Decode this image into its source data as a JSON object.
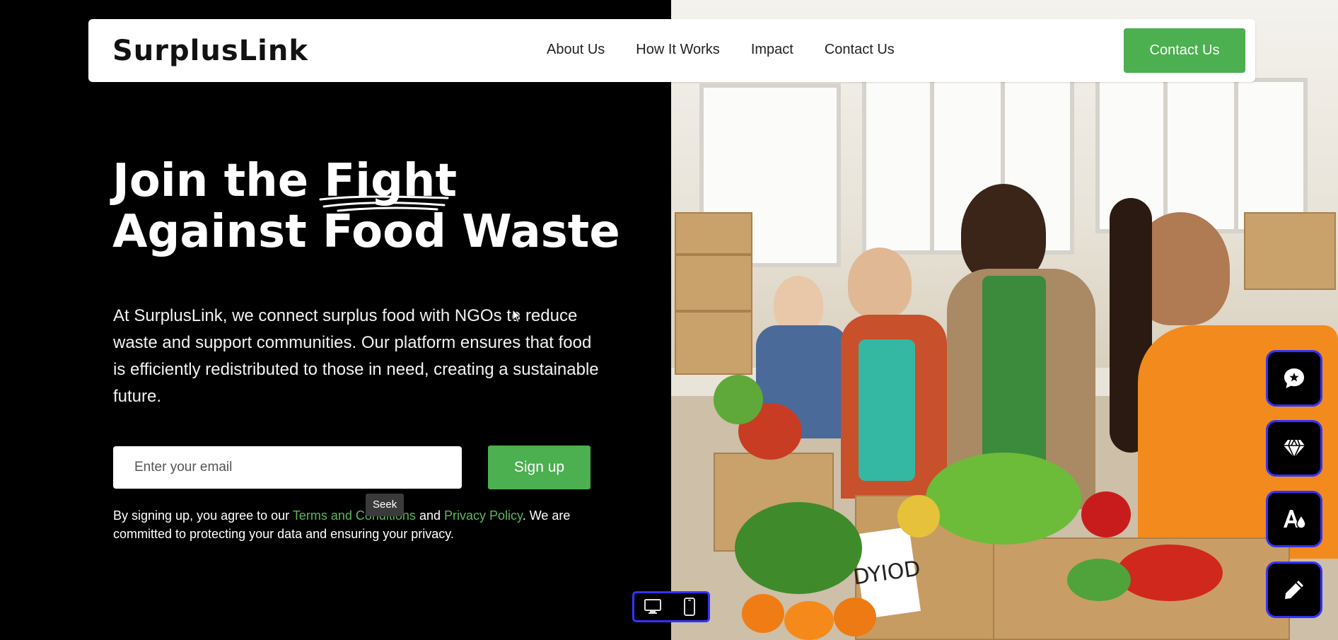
{
  "brand": {
    "logo": "SurplusLink",
    "accent_color": "#4caf50"
  },
  "nav": {
    "links": [
      "About Us",
      "How It Works",
      "Impact",
      "Contact Us"
    ],
    "cta_label": "Contact Us"
  },
  "hero": {
    "title_before": "Join the ",
    "title_highlight": "Fight",
    "title_after": " Against Food Waste",
    "description": "At SurplusLink, we connect surplus food with NGOs to reduce waste and support communities. Our platform ensures that food is efficiently redistributed to those in need, creating a sustainable future.",
    "email_placeholder": "Enter your email",
    "signup_label": "Sign up",
    "terms_before": "By signing up, you agree to our ",
    "terms_link": "Terms and Conditions",
    "terms_and": " and ",
    "privacy_link": "Privacy Policy",
    "terms_after": ". We are committed to protecting your data and ensuring your privacy."
  },
  "tooltip": {
    "text": "Seek"
  },
  "device_toggle": {
    "icons": [
      "desktop-icon",
      "mobile-icon"
    ]
  },
  "side_tools": {
    "icons": [
      "chat-star-icon",
      "diamond-icon",
      "text-color-icon",
      "pencil-icon"
    ]
  },
  "photo": {
    "box_label": "DYIOD"
  }
}
